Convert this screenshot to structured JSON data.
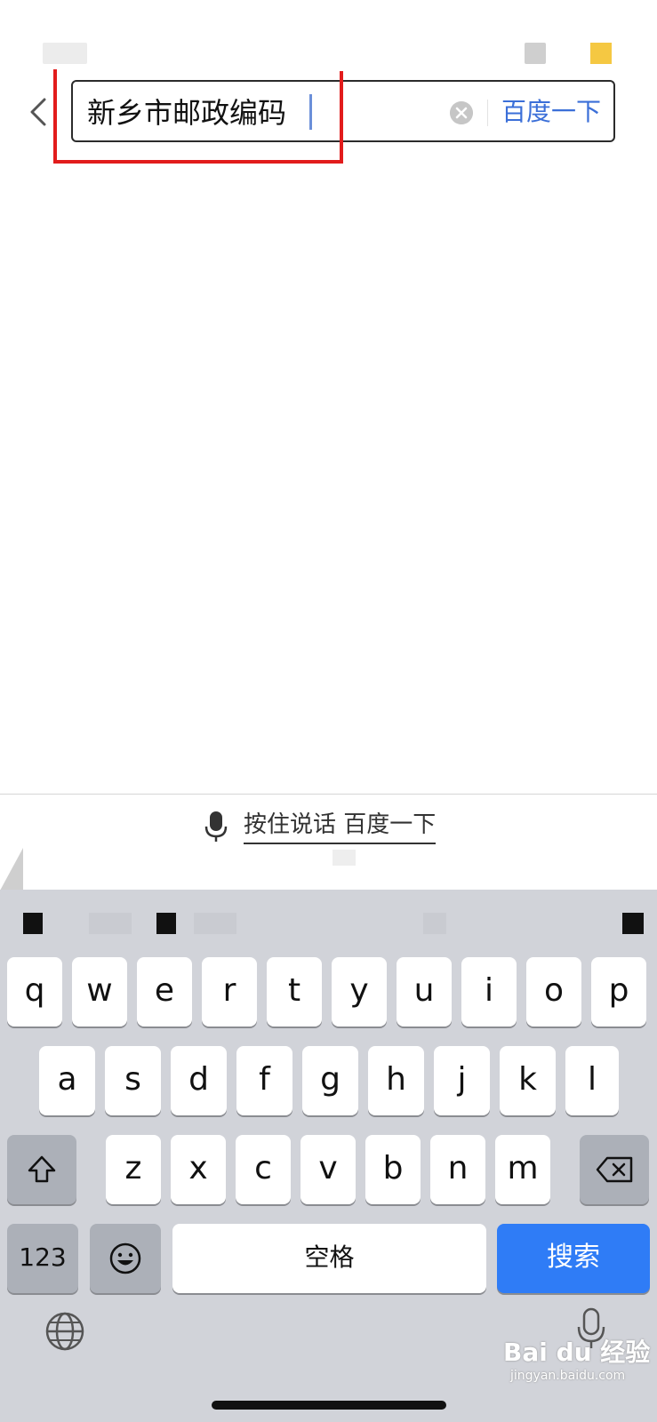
{
  "search": {
    "query": "新乡市邮政编码",
    "submit_label": "百度一下"
  },
  "voice_bar": {
    "label": "按住说话 百度一下"
  },
  "keyboard": {
    "row1": [
      "q",
      "w",
      "e",
      "r",
      "t",
      "y",
      "u",
      "i",
      "o",
      "p"
    ],
    "row2": [
      "a",
      "s",
      "d",
      "f",
      "g",
      "h",
      "j",
      "k",
      "l"
    ],
    "row3": [
      "z",
      "x",
      "c",
      "v",
      "b",
      "n",
      "m"
    ],
    "numbers_label": "123",
    "space_label": "空格",
    "search_label": "搜索"
  },
  "watermark": {
    "brand": "Bai du 经验",
    "url": "jingyan.baidu.com"
  },
  "colors": {
    "accent": "#3b6fd8",
    "search_key": "#2f7cf6",
    "highlight": "#e21c1c",
    "keyboard_bg": "#d1d3d9"
  }
}
